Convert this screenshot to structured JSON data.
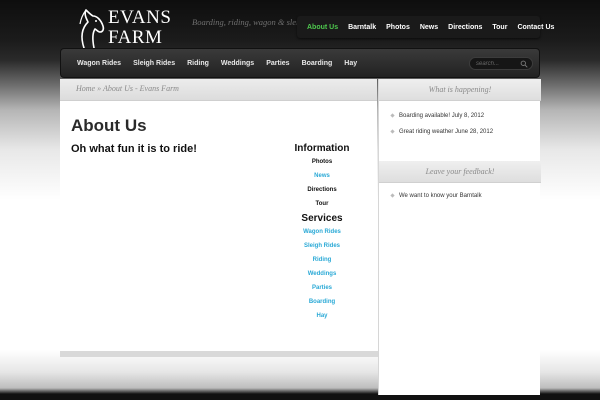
{
  "site": {
    "logo_text_line1": "EVANS",
    "logo_text_line2": "FARM",
    "tagline": "Boarding, riding, wagon & sleigh"
  },
  "topnav": {
    "items": [
      {
        "label": "About Us"
      },
      {
        "label": "Barntalk"
      },
      {
        "label": "Photos"
      },
      {
        "label": "News"
      },
      {
        "label": "Directions"
      },
      {
        "label": "Tour"
      },
      {
        "label": "Contact Us"
      }
    ],
    "active_color": "#4ec94e"
  },
  "mainnav": {
    "items": [
      {
        "label": "Wagon Rides"
      },
      {
        "label": "Sleigh Rides"
      },
      {
        "label": "Riding"
      },
      {
        "label": "Weddings"
      },
      {
        "label": "Parties"
      },
      {
        "label": "Boarding"
      },
      {
        "label": "Hay"
      }
    ],
    "search_placeholder": "search..."
  },
  "main": {
    "breadcrumb": "Home » About Us - Evans Farm",
    "title": "About Us",
    "subtitle": "Oh what fun it is to ride!",
    "info_heading": "Information",
    "info_links": [
      {
        "label": "Photos"
      },
      {
        "label": "News"
      },
      {
        "label": "Directions"
      },
      {
        "label": "Tour"
      }
    ],
    "services_heading": "Services",
    "service_links": [
      {
        "label": "Wagon Rides"
      },
      {
        "label": "Sleigh Rides"
      },
      {
        "label": "Riding"
      },
      {
        "label": "Weddings"
      },
      {
        "label": "Parties"
      },
      {
        "label": "Boarding"
      },
      {
        "label": "Hay"
      }
    ],
    "link_color": "#2aa9d6"
  },
  "sidebar": {
    "happening_title": "What is happening!",
    "happening_items": [
      {
        "label": "Boarding available! July 8, 2012"
      },
      {
        "label": "Great riding weather June 28, 2012"
      }
    ],
    "feedback_title": "Leave your feedback!",
    "feedback_items": [
      {
        "label": "We want to know your Barntalk"
      }
    ]
  }
}
